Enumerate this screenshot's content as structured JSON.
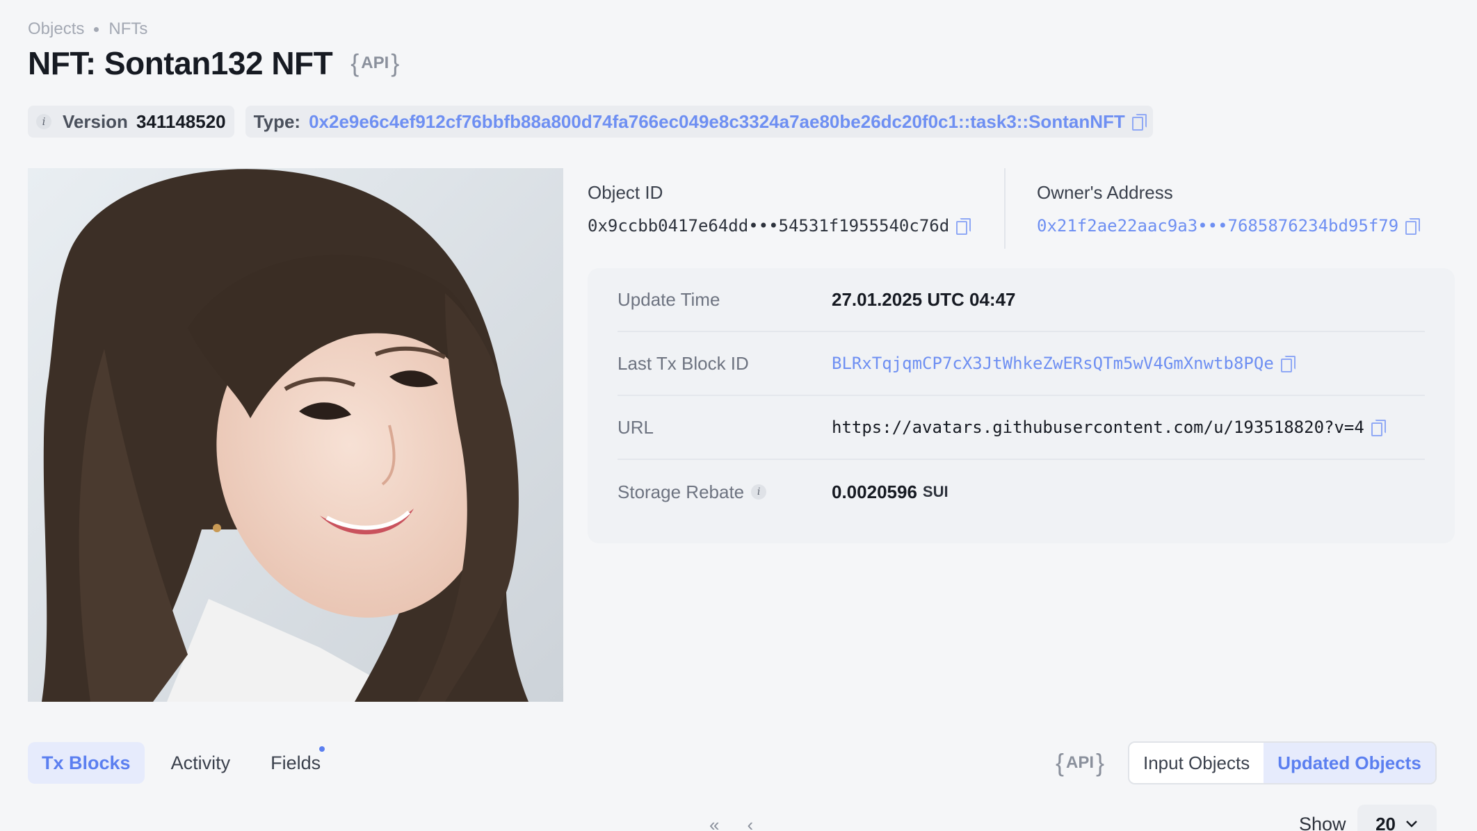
{
  "breadcrumb": {
    "items": [
      "Objects",
      "NFTs"
    ]
  },
  "title": "NFT: Sontan132 NFT",
  "api_label": "API",
  "version": {
    "label": "Version",
    "value": "341148520"
  },
  "type": {
    "label": "Type:",
    "value": "0x2e9e6c4ef912cf76bbfb88a800d74fa766ec049e8c3324a7ae80be26dc20f0c1::task3::SontanNFT"
  },
  "object_id": {
    "label": "Object ID",
    "value": "0x9ccbb0417e64dd•••54531f1955540c76d"
  },
  "owner": {
    "label": "Owner's Address",
    "value": "0x21f2ae22aac9a3•••7685876234bd95f79"
  },
  "details": {
    "update_time": {
      "label": "Update Time",
      "value": "27.01.2025 UTC 04:47"
    },
    "last_tx": {
      "label": "Last Tx Block ID",
      "value": "BLRxTqjqmCP7cX3JtWhkeZwERsQTm5wV4GmXnwtb8PQe"
    },
    "url": {
      "label": "URL",
      "value": "https://avatars.githubusercontent.com/u/193518820?v=4"
    },
    "storage_rebate": {
      "label": "Storage Rebate",
      "value": "0.0020596",
      "unit": "SUI"
    }
  },
  "tabs": [
    "Tx Blocks",
    "Activity",
    "Fields"
  ],
  "toggle": {
    "input": "Input Objects",
    "updated": "Updated Objects"
  },
  "pagination": {
    "first": "«",
    "prev": "‹"
  },
  "show": {
    "label": "Show",
    "value": "20"
  },
  "icons": {
    "copy": "copy-icon",
    "info": "info-icon",
    "chevron": "chevron-down-icon"
  },
  "colors": {
    "accent": "#6e8ff2",
    "background": "#f5f6f8",
    "card": "#f0f2f5"
  }
}
